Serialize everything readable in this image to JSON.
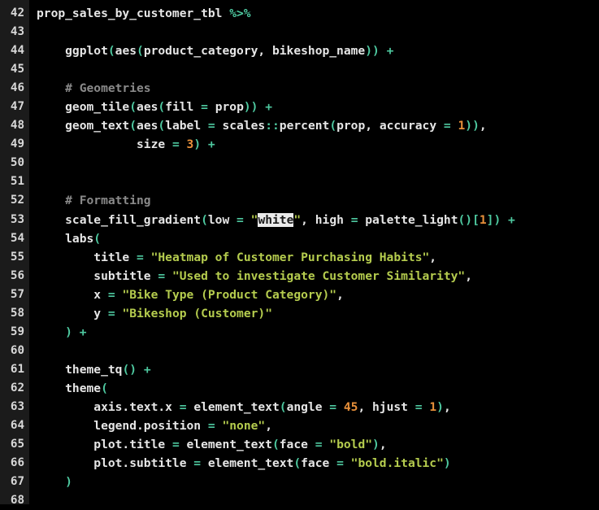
{
  "editor": {
    "name": "code-editor",
    "language": "R",
    "theme": {
      "background": "#000000",
      "gutter_background": "#1b1b1b",
      "text": "#e6e6e6",
      "operator": "#4ec9a0",
      "number": "#e8903a",
      "string": "#b5cc4e",
      "comment": "#8a8a8a",
      "selection_background": "#eaeaea",
      "selection_text": "#1a1a1a"
    },
    "first_line_number": 42,
    "last_line_number": 68,
    "selected_text": "white",
    "lines": [
      {
        "num": "42",
        "tokens": [
          {
            "t": "prop_sales_by_customer_tbl ",
            "c": "t-plain"
          },
          {
            "t": "%>%",
            "c": "t-op"
          }
        ]
      },
      {
        "num": "43",
        "tokens": []
      },
      {
        "num": "44",
        "tokens": [
          {
            "t": "    ggplot",
            "c": "t-plain"
          },
          {
            "t": "(",
            "c": "t-punct"
          },
          {
            "t": "aes",
            "c": "t-plain"
          },
          {
            "t": "(",
            "c": "t-punct"
          },
          {
            "t": "product_category, bikeshop_name",
            "c": "t-plain"
          },
          {
            "t": "))",
            "c": "t-punct"
          },
          {
            "t": " ",
            "c": "t-plain"
          },
          {
            "t": "+",
            "c": "t-op"
          }
        ]
      },
      {
        "num": "45",
        "tokens": []
      },
      {
        "num": "46",
        "tokens": [
          {
            "t": "    # Geometries",
            "c": "t-comment"
          }
        ]
      },
      {
        "num": "47",
        "tokens": [
          {
            "t": "    geom_tile",
            "c": "t-plain"
          },
          {
            "t": "(",
            "c": "t-punct"
          },
          {
            "t": "aes",
            "c": "t-plain"
          },
          {
            "t": "(",
            "c": "t-punct"
          },
          {
            "t": "fill ",
            "c": "t-plain"
          },
          {
            "t": "=",
            "c": "t-op"
          },
          {
            "t": " prop",
            "c": "t-plain"
          },
          {
            "t": "))",
            "c": "t-punct"
          },
          {
            "t": " ",
            "c": "t-plain"
          },
          {
            "t": "+",
            "c": "t-op"
          }
        ]
      },
      {
        "num": "48",
        "tokens": [
          {
            "t": "    geom_text",
            "c": "t-plain"
          },
          {
            "t": "(",
            "c": "t-punct"
          },
          {
            "t": "aes",
            "c": "t-plain"
          },
          {
            "t": "(",
            "c": "t-punct"
          },
          {
            "t": "label ",
            "c": "t-plain"
          },
          {
            "t": "=",
            "c": "t-op"
          },
          {
            "t": " scales",
            "c": "t-plain"
          },
          {
            "t": "::",
            "c": "t-op"
          },
          {
            "t": "percent",
            "c": "t-plain"
          },
          {
            "t": "(",
            "c": "t-punct"
          },
          {
            "t": "prop, accuracy ",
            "c": "t-plain"
          },
          {
            "t": "=",
            "c": "t-op"
          },
          {
            "t": " ",
            "c": "t-plain"
          },
          {
            "t": "1",
            "c": "t-num"
          },
          {
            "t": "))",
            "c": "t-punct"
          },
          {
            "t": ",",
            "c": "t-plain"
          }
        ]
      },
      {
        "num": "49",
        "tokens": [
          {
            "t": "              size ",
            "c": "t-plain"
          },
          {
            "t": "=",
            "c": "t-op"
          },
          {
            "t": " ",
            "c": "t-plain"
          },
          {
            "t": "3",
            "c": "t-num"
          },
          {
            "t": ")",
            "c": "t-punct"
          },
          {
            "t": " ",
            "c": "t-plain"
          },
          {
            "t": "+",
            "c": "t-op"
          }
        ]
      },
      {
        "num": "50",
        "tokens": []
      },
      {
        "num": "51",
        "tokens": []
      },
      {
        "num": "52",
        "tokens": [
          {
            "t": "    # Formatting",
            "c": "t-comment"
          }
        ]
      },
      {
        "num": "53",
        "tokens": [
          {
            "t": "    scale_fill_gradient",
            "c": "t-plain"
          },
          {
            "t": "(",
            "c": "t-punct"
          },
          {
            "t": "low ",
            "c": "t-plain"
          },
          {
            "t": "=",
            "c": "t-op"
          },
          {
            "t": " ",
            "c": "t-plain"
          },
          {
            "t": "\"",
            "c": "t-str"
          },
          {
            "t": "white",
            "c": "t-sel"
          },
          {
            "t": "\"",
            "c": "t-str"
          },
          {
            "t": ", high ",
            "c": "t-plain"
          },
          {
            "t": "=",
            "c": "t-op"
          },
          {
            "t": " palette_light",
            "c": "t-plain"
          },
          {
            "t": "()",
            "c": "t-punct"
          },
          {
            "t": "[",
            "c": "t-punct"
          },
          {
            "t": "1",
            "c": "t-num"
          },
          {
            "t": "])",
            "c": "t-punct"
          },
          {
            "t": " ",
            "c": "t-plain"
          },
          {
            "t": "+",
            "c": "t-op"
          }
        ]
      },
      {
        "num": "54",
        "tokens": [
          {
            "t": "    labs",
            "c": "t-plain"
          },
          {
            "t": "(",
            "c": "t-punct"
          }
        ]
      },
      {
        "num": "55",
        "tokens": [
          {
            "t": "        title ",
            "c": "t-plain"
          },
          {
            "t": "=",
            "c": "t-op"
          },
          {
            "t": " ",
            "c": "t-plain"
          },
          {
            "t": "\"Heatmap of Customer Purchasing Habits\"",
            "c": "t-str"
          },
          {
            "t": ",",
            "c": "t-plain"
          }
        ]
      },
      {
        "num": "56",
        "tokens": [
          {
            "t": "        subtitle ",
            "c": "t-plain"
          },
          {
            "t": "=",
            "c": "t-op"
          },
          {
            "t": " ",
            "c": "t-plain"
          },
          {
            "t": "\"Used to investigate Customer Similarity\"",
            "c": "t-str"
          },
          {
            "t": ",",
            "c": "t-plain"
          }
        ]
      },
      {
        "num": "57",
        "tokens": [
          {
            "t": "        x ",
            "c": "t-plain"
          },
          {
            "t": "=",
            "c": "t-op"
          },
          {
            "t": " ",
            "c": "t-plain"
          },
          {
            "t": "\"Bike Type (Product Category)\"",
            "c": "t-str"
          },
          {
            "t": ",",
            "c": "t-plain"
          }
        ]
      },
      {
        "num": "58",
        "tokens": [
          {
            "t": "        y ",
            "c": "t-plain"
          },
          {
            "t": "=",
            "c": "t-op"
          },
          {
            "t": " ",
            "c": "t-plain"
          },
          {
            "t": "\"Bikeshop (Customer)\"",
            "c": "t-str"
          }
        ]
      },
      {
        "num": "59",
        "tokens": [
          {
            "t": "    ",
            "c": "t-plain"
          },
          {
            "t": ")",
            "c": "t-punct"
          },
          {
            "t": " ",
            "c": "t-plain"
          },
          {
            "t": "+",
            "c": "t-op"
          }
        ]
      },
      {
        "num": "60",
        "tokens": []
      },
      {
        "num": "61",
        "tokens": [
          {
            "t": "    theme_tq",
            "c": "t-plain"
          },
          {
            "t": "()",
            "c": "t-punct"
          },
          {
            "t": " ",
            "c": "t-plain"
          },
          {
            "t": "+",
            "c": "t-op"
          }
        ]
      },
      {
        "num": "62",
        "tokens": [
          {
            "t": "    theme",
            "c": "t-plain"
          },
          {
            "t": "(",
            "c": "t-punct"
          }
        ]
      },
      {
        "num": "63",
        "tokens": [
          {
            "t": "        axis.text.x ",
            "c": "t-plain"
          },
          {
            "t": "=",
            "c": "t-op"
          },
          {
            "t": " element_text",
            "c": "t-plain"
          },
          {
            "t": "(",
            "c": "t-punct"
          },
          {
            "t": "angle ",
            "c": "t-plain"
          },
          {
            "t": "=",
            "c": "t-op"
          },
          {
            "t": " ",
            "c": "t-plain"
          },
          {
            "t": "45",
            "c": "t-num"
          },
          {
            "t": ", hjust ",
            "c": "t-plain"
          },
          {
            "t": "=",
            "c": "t-op"
          },
          {
            "t": " ",
            "c": "t-plain"
          },
          {
            "t": "1",
            "c": "t-num"
          },
          {
            "t": ")",
            "c": "t-punct"
          },
          {
            "t": ",",
            "c": "t-plain"
          }
        ]
      },
      {
        "num": "64",
        "tokens": [
          {
            "t": "        legend.position ",
            "c": "t-plain"
          },
          {
            "t": "=",
            "c": "t-op"
          },
          {
            "t": " ",
            "c": "t-plain"
          },
          {
            "t": "\"none\"",
            "c": "t-str"
          },
          {
            "t": ",",
            "c": "t-plain"
          }
        ]
      },
      {
        "num": "65",
        "tokens": [
          {
            "t": "        plot.title ",
            "c": "t-plain"
          },
          {
            "t": "=",
            "c": "t-op"
          },
          {
            "t": " element_text",
            "c": "t-plain"
          },
          {
            "t": "(",
            "c": "t-punct"
          },
          {
            "t": "face ",
            "c": "t-plain"
          },
          {
            "t": "=",
            "c": "t-op"
          },
          {
            "t": " ",
            "c": "t-plain"
          },
          {
            "t": "\"bold\"",
            "c": "t-str"
          },
          {
            "t": ")",
            "c": "t-punct"
          },
          {
            "t": ",",
            "c": "t-plain"
          }
        ]
      },
      {
        "num": "66",
        "tokens": [
          {
            "t": "        plot.subtitle ",
            "c": "t-plain"
          },
          {
            "t": "=",
            "c": "t-op"
          },
          {
            "t": " element_text",
            "c": "t-plain"
          },
          {
            "t": "(",
            "c": "t-punct"
          },
          {
            "t": "face ",
            "c": "t-plain"
          },
          {
            "t": "=",
            "c": "t-op"
          },
          {
            "t": " ",
            "c": "t-plain"
          },
          {
            "t": "\"bold.italic\"",
            "c": "t-str"
          },
          {
            "t": ")",
            "c": "t-punct"
          }
        ]
      },
      {
        "num": "67",
        "tokens": [
          {
            "t": "    ",
            "c": "t-plain"
          },
          {
            "t": ")",
            "c": "t-punct"
          }
        ]
      },
      {
        "num": "68",
        "tokens": []
      }
    ]
  }
}
